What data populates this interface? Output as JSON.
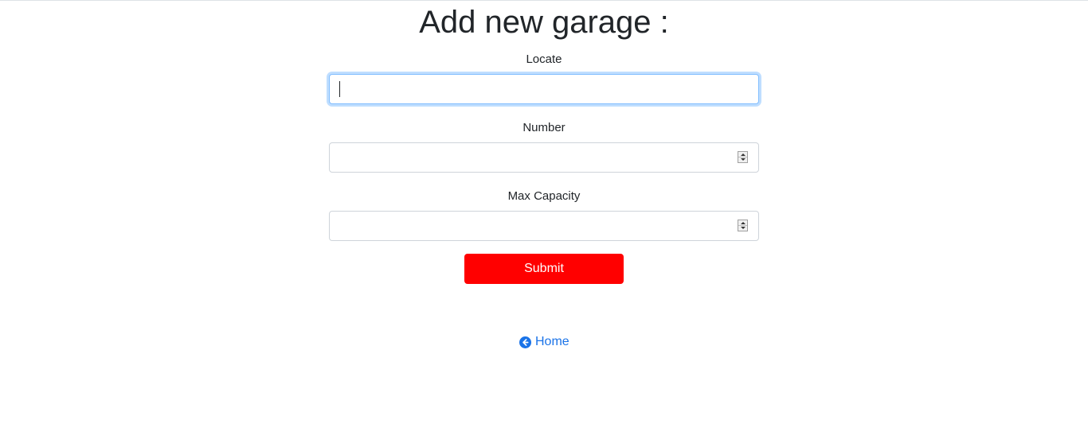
{
  "page": {
    "title": "Add new garage :"
  },
  "form": {
    "locate": {
      "label": "Locate",
      "value": "",
      "placeholder": ""
    },
    "number": {
      "label": "Number",
      "value": "",
      "placeholder": ""
    },
    "max_capacity": {
      "label": "Max Capacity",
      "value": "",
      "placeholder": ""
    },
    "submit_label": "Submit"
  },
  "nav": {
    "home_label": "Home",
    "home_icon": "arrow-circle-left-icon"
  },
  "colors": {
    "submit_bg": "#ff0000",
    "link": "#1a73e8",
    "focus_border": "#80bdff"
  }
}
